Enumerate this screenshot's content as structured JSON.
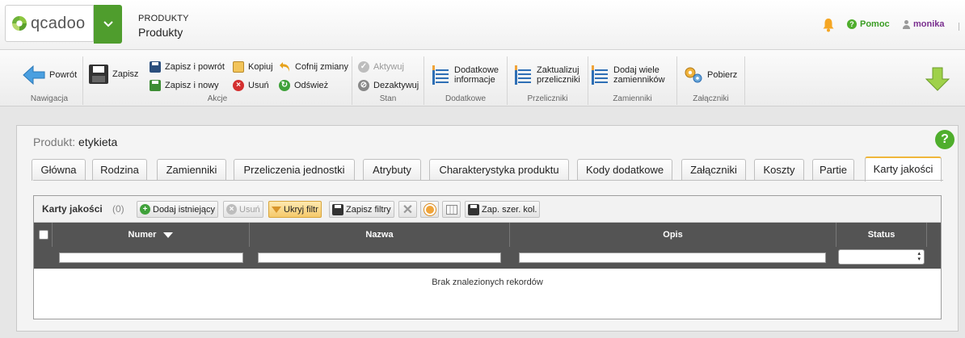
{
  "header": {
    "logo_text": "qcadoo",
    "breadcrumb_category": "PRODUKTY",
    "breadcrumb_page": "Produkty",
    "help_label": "Pomoc",
    "user_name": "monika",
    "accent_green": "#4f9d2d",
    "help_green": "#3a9d23",
    "user_purple": "#7a2f8f"
  },
  "ribbon": {
    "groups": {
      "navigation": "Nawigacja",
      "actions": "Akcje",
      "state": "Stan",
      "additional": "Dodatkowe",
      "converters": "Przeliczniki",
      "substitutes": "Zamienniki",
      "attachments": "Załączniki"
    },
    "buttons": {
      "back": "Powrót",
      "save": "Zapisz",
      "save_and_back": "Zapisz i powrót",
      "save_and_new": "Zapisz i nowy",
      "copy": "Kopiuj",
      "delete": "Usuń",
      "undo": "Cofnij zmiany",
      "refresh": "Odśwież",
      "activate": "Aktywuj",
      "deactivate": "Dezaktywuj",
      "additional_info_line1": "Dodatkowe",
      "additional_info_line2": "informacje",
      "update_converters_line1": "Zaktualizuj",
      "update_converters_line2": "przeliczniki",
      "add_many_substitutes_line1": "Dodaj wiele",
      "add_many_substitutes_line2": "zamienników",
      "download": "Pobierz"
    }
  },
  "panel": {
    "title_prefix": "Produkt:",
    "title_value": "etykieta",
    "tabs": [
      "Główna",
      "Rodzina",
      "Zamienniki",
      "Przeliczenia jednostki",
      "Atrybuty",
      "Charakterystyka produktu",
      "Kody dodatkowe",
      "Załączniki",
      "Koszty",
      "Partie",
      "Karty jakości"
    ],
    "active_tab": "Karty jakości"
  },
  "grid": {
    "title": "Karty jakości",
    "count": "(0)",
    "toolbar": {
      "add_existing": "Dodaj istniejący",
      "remove": "Usuń",
      "hide_filter": "Ukryj filtr",
      "save_filters": "Zapisz filtry",
      "save_column_widths": "Zap. szer. kol."
    },
    "columns": [
      "Numer",
      "Nazwa",
      "Opis",
      "Status"
    ],
    "sorted_column": "Numer",
    "sort_direction": "descending",
    "status_filter_value": "",
    "empty_message": "Brak znalezionych rekordów"
  }
}
